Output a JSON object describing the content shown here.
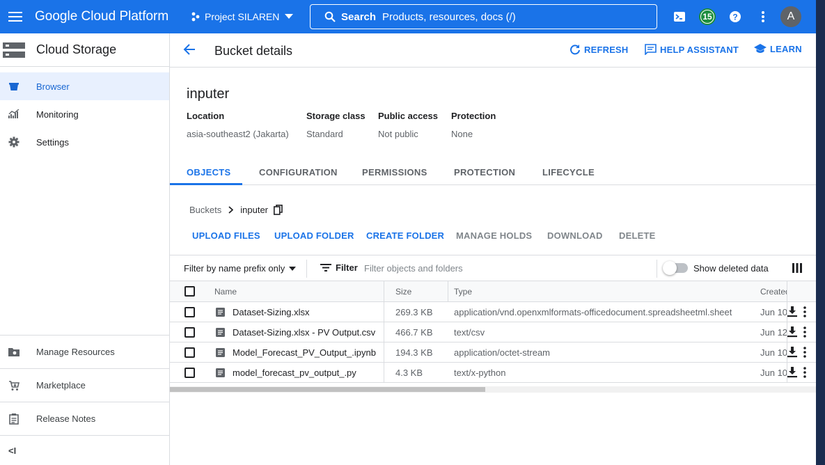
{
  "topbar": {
    "brand": "Google Cloud Platform",
    "project": "Project SILAREN",
    "search_label": "Search",
    "search_placeholder": "Products, resources, docs (/)",
    "notification_count": "15",
    "avatar_letter": "A"
  },
  "sidebar": {
    "product_title": "Cloud Storage",
    "items": [
      {
        "label": "Browser",
        "icon": "bucket-icon",
        "active": true
      },
      {
        "label": "Monitoring",
        "icon": "chart-icon",
        "active": false
      },
      {
        "label": "Settings",
        "icon": "gear-icon",
        "active": false
      }
    ],
    "bottom_items": [
      {
        "label": "Manage Resources",
        "icon": "folder-gear-icon"
      },
      {
        "label": "Marketplace",
        "icon": "cart-icon"
      },
      {
        "label": "Release Notes",
        "icon": "notes-icon"
      }
    ],
    "collapse_label": "<I"
  },
  "header": {
    "title": "Bucket details",
    "refresh": "REFRESH",
    "help_assistant": "HELP ASSISTANT",
    "learn": "LEARN"
  },
  "bucket": {
    "name": "inputer",
    "meta": [
      {
        "key": "Location",
        "value": "asia-southeast2 (Jakarta)"
      },
      {
        "key": "Storage class",
        "value": "Standard"
      },
      {
        "key": "Public access",
        "value": "Not public"
      },
      {
        "key": "Protection",
        "value": "None"
      }
    ]
  },
  "tabs": [
    "OBJECTS",
    "CONFIGURATION",
    "PERMISSIONS",
    "PROTECTION",
    "LIFECYCLE"
  ],
  "breadcrumb": {
    "root": "Buckets",
    "current": "inputer"
  },
  "actions": [
    "UPLOAD FILES",
    "UPLOAD FOLDER",
    "CREATE FOLDER",
    "MANAGE HOLDS",
    "DOWNLOAD",
    "DELETE"
  ],
  "filterbar": {
    "prefix_select": "Filter by name prefix only",
    "filter_label": "Filter",
    "filter_placeholder": "Filter objects and folders",
    "show_deleted": "Show deleted data"
  },
  "table": {
    "columns": [
      "Name",
      "Size",
      "Type",
      "Created"
    ],
    "rows": [
      {
        "name": "Dataset-Sizing.xlsx",
        "size": "269.3 KB",
        "type": "application/vnd.openxmlformats-officedocument.spreadsheetml.sheet",
        "created": "Jun 10"
      },
      {
        "name": "Dataset-Sizing.xlsx - PV Output.csv",
        "size": "466.7 KB",
        "type": "text/csv",
        "created": "Jun 12"
      },
      {
        "name": "Model_Forecast_PV_Output_.ipynb",
        "size": "194.3 KB",
        "type": "application/octet-stream",
        "created": "Jun 10"
      },
      {
        "name": "model_forecast_pv_output_.py",
        "size": "4.3 KB",
        "type": "text/x-python",
        "created": "Jun 10"
      }
    ]
  },
  "colors": {
    "primary": "#1a73e8",
    "active_bg": "#e8f0fe",
    "badge": "#1e8e3e"
  }
}
